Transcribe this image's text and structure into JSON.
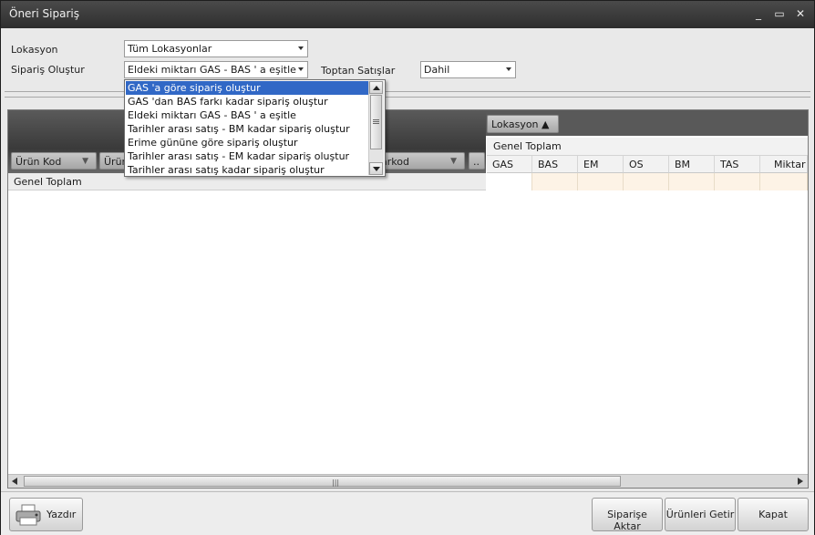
{
  "window": {
    "title": "Öneri Sipariş",
    "controls": {
      "minimize": "_",
      "maximize": "▭",
      "close": "✕"
    }
  },
  "form": {
    "lokasyon_label": "Lokasyon",
    "lokasyon_value": "Tüm Lokasyonlar",
    "siparis_label": "Sipariş Oluştur",
    "siparis_value": "Eldeki miktarı GAS - BAS ' a eşitle",
    "toptan_label": "Toptan Satışlar",
    "toptan_value": "Dahil"
  },
  "dropdown": {
    "options": [
      "GAS 'a göre sipariş oluştur",
      "GAS 'dan BAS farkı kadar sipariş oluştur",
      "Eldeki miktarı GAS - BAS ' a eşitle",
      "Tarihler arası satış - BM kadar sipariş oluştur",
      "Erime gününe göre sipariş oluştur",
      "Tarihler arası satış - EM kadar sipariş oluştur",
      "Tarihler arası satış kadar sipariş oluştur"
    ],
    "selected_index": 0
  },
  "grid": {
    "row_headers": {
      "urun_kod": "Ürün Kod",
      "urun_partial": "Ürün",
      "barkod_partial": "arkod",
      "more": ".."
    },
    "column_area_button": "Lokasyon ▲",
    "genel_toplam": "Genel Toplam",
    "columns": [
      "GAS",
      "BAS",
      "EM",
      "OS",
      "BM",
      "TAS",
      "Miktar"
    ],
    "row_total_label": "Genel Toplam"
  },
  "footer": {
    "print_label": "Yazdır",
    "transfer_label": "Siparişe Aktar",
    "fetch_label": "Ürünleri Getir",
    "close_label": "Kapat"
  },
  "colors": {
    "selection": "#3168c6",
    "cell_fill": "#fdf3e6",
    "header_dark": "#4a4a4a"
  }
}
